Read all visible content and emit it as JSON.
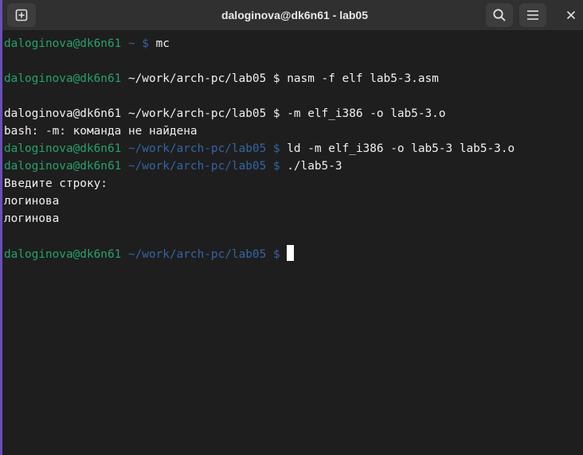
{
  "window": {
    "title": "daloginova@dk6n61 - lab05"
  },
  "titlebar": {
    "new_tab_icon": "new-tab-icon",
    "search_icon": "search-icon",
    "menu_icon": "hamburger-menu-icon",
    "close_icon": "close-icon"
  },
  "colors": {
    "prompt_user": "#26a269",
    "prompt_path": "#3465a4",
    "text": "#f0f0f0",
    "background": "#1e1e1e"
  },
  "terminal": {
    "lines": [
      {
        "user": "daloginova@dk6n61",
        "path": " ~ $ ",
        "path_dim": true,
        "cmd": "mc"
      },
      {
        "text": ""
      },
      {
        "user": "daloginova@dk6n61",
        "path": " ~/work/arch-pc/lab05 $ ",
        "path_dim": false,
        "cmd": "nasm -f elf lab5-3.asm"
      },
      {
        "text": ""
      },
      {
        "user": "daloginova@dk6n61",
        "path": " ~/work/arch-pc/lab05 $ ",
        "path_dim": false,
        "cmd": "-m elf_i386 -o lab5-3.o",
        "user_plain": true
      },
      {
        "text": "bash: -m: команда не найдена"
      },
      {
        "user": "daloginova@dk6n61",
        "path": " ~/work/arch-pc/lab05 $ ",
        "path_dim": true,
        "cmd": "ld -m elf_i386 -o lab5-3 lab5-3.o"
      },
      {
        "user": "daloginova@dk6n61",
        "path": " ~/work/arch-pc/lab05 $ ",
        "path_dim": true,
        "cmd": "./lab5-3"
      },
      {
        "text": "Введите строку:"
      },
      {
        "text": "логинова"
      },
      {
        "text": "логинова"
      },
      {
        "text": ""
      },
      {
        "user": "daloginova@dk6n61",
        "path": " ~/work/arch-pc/lab05 $ ",
        "path_dim": true,
        "cmd": "",
        "cursor": true
      }
    ]
  }
}
